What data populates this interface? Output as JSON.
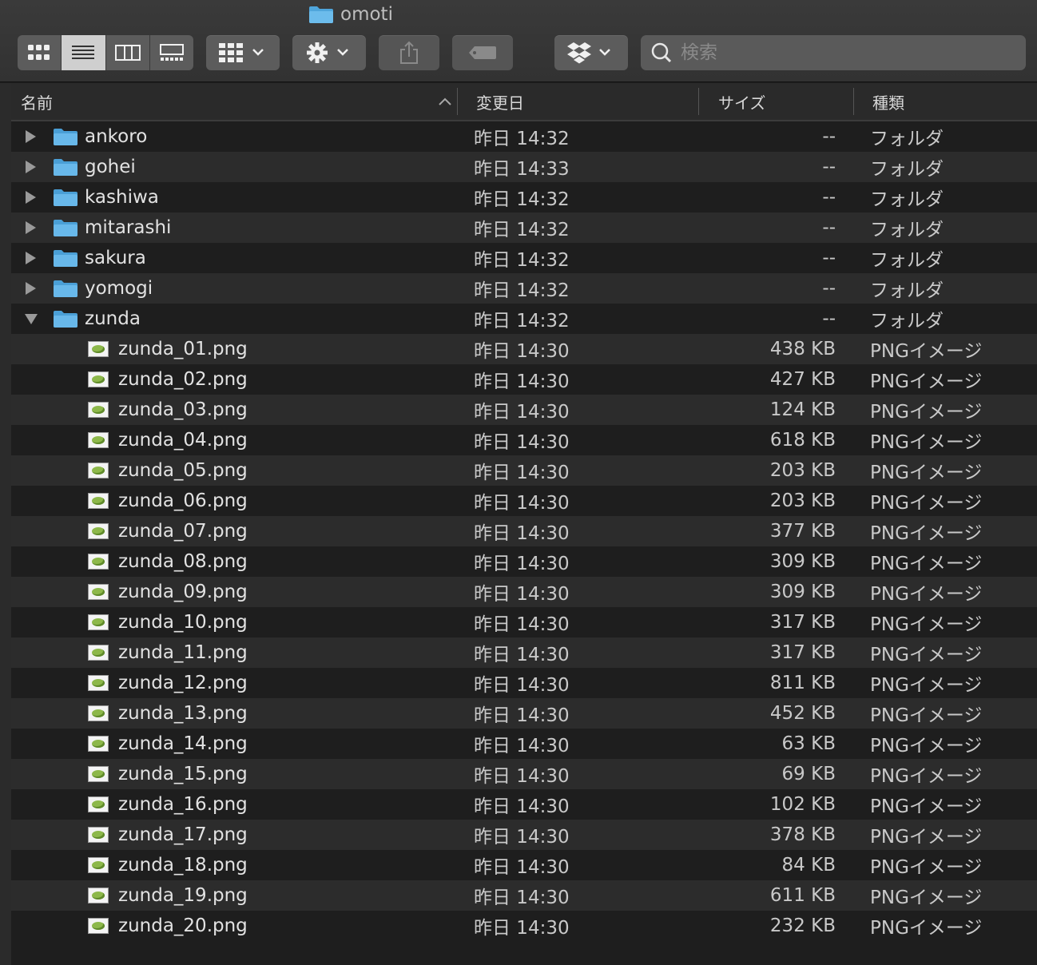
{
  "window": {
    "title": "omoti"
  },
  "toolbar": {
    "view_icons": [
      "icon-view-icon",
      "list-view-icon",
      "column-view-icon",
      "gallery-view-icon"
    ],
    "active_view": "list",
    "search_placeholder": "検索"
  },
  "columns": {
    "name": "名前",
    "modified": "変更日",
    "size": "サイズ",
    "kind": "種類"
  },
  "folders": [
    {
      "name": "ankoro",
      "date": "昨日 14:32",
      "size": "--",
      "kind": "フォルダ",
      "expanded": false
    },
    {
      "name": "gohei",
      "date": "昨日 14:33",
      "size": "--",
      "kind": "フォルダ",
      "expanded": false
    },
    {
      "name": "kashiwa",
      "date": "昨日 14:32",
      "size": "--",
      "kind": "フォルダ",
      "expanded": false
    },
    {
      "name": "mitarashi",
      "date": "昨日 14:32",
      "size": "--",
      "kind": "フォルダ",
      "expanded": false
    },
    {
      "name": "sakura",
      "date": "昨日 14:32",
      "size": "--",
      "kind": "フォルダ",
      "expanded": false
    },
    {
      "name": "yomogi",
      "date": "昨日 14:32",
      "size": "--",
      "kind": "フォルダ",
      "expanded": false
    },
    {
      "name": "zunda",
      "date": "昨日 14:32",
      "size": "--",
      "kind": "フォルダ",
      "expanded": true
    }
  ],
  "files": [
    {
      "name": "zunda_01.png",
      "date": "昨日 14:30",
      "size": "438 KB",
      "kind": "PNGイメージ"
    },
    {
      "name": "zunda_02.png",
      "date": "昨日 14:30",
      "size": "427 KB",
      "kind": "PNGイメージ"
    },
    {
      "name": "zunda_03.png",
      "date": "昨日 14:30",
      "size": "124 KB",
      "kind": "PNGイメージ"
    },
    {
      "name": "zunda_04.png",
      "date": "昨日 14:30",
      "size": "618 KB",
      "kind": "PNGイメージ"
    },
    {
      "name": "zunda_05.png",
      "date": "昨日 14:30",
      "size": "203 KB",
      "kind": "PNGイメージ"
    },
    {
      "name": "zunda_06.png",
      "date": "昨日 14:30",
      "size": "203 KB",
      "kind": "PNGイメージ"
    },
    {
      "name": "zunda_07.png",
      "date": "昨日 14:30",
      "size": "377 KB",
      "kind": "PNGイメージ"
    },
    {
      "name": "zunda_08.png",
      "date": "昨日 14:30",
      "size": "309 KB",
      "kind": "PNGイメージ"
    },
    {
      "name": "zunda_09.png",
      "date": "昨日 14:30",
      "size": "309 KB",
      "kind": "PNGイメージ"
    },
    {
      "name": "zunda_10.png",
      "date": "昨日 14:30",
      "size": "317 KB",
      "kind": "PNGイメージ"
    },
    {
      "name": "zunda_11.png",
      "date": "昨日 14:30",
      "size": "317 KB",
      "kind": "PNGイメージ"
    },
    {
      "name": "zunda_12.png",
      "date": "昨日 14:30",
      "size": "811 KB",
      "kind": "PNGイメージ"
    },
    {
      "name": "zunda_13.png",
      "date": "昨日 14:30",
      "size": "452 KB",
      "kind": "PNGイメージ"
    },
    {
      "name": "zunda_14.png",
      "date": "昨日 14:30",
      "size": "63 KB",
      "kind": "PNGイメージ"
    },
    {
      "name": "zunda_15.png",
      "date": "昨日 14:30",
      "size": "69 KB",
      "kind": "PNGイメージ"
    },
    {
      "name": "zunda_16.png",
      "date": "昨日 14:30",
      "size": "102 KB",
      "kind": "PNGイメージ"
    },
    {
      "name": "zunda_17.png",
      "date": "昨日 14:30",
      "size": "378 KB",
      "kind": "PNGイメージ"
    },
    {
      "name": "zunda_18.png",
      "date": "昨日 14:30",
      "size": "84 KB",
      "kind": "PNGイメージ"
    },
    {
      "name": "zunda_19.png",
      "date": "昨日 14:30",
      "size": "611 KB",
      "kind": "PNGイメージ"
    },
    {
      "name": "zunda_20.png",
      "date": "昨日 14:30",
      "size": "232 KB",
      "kind": "PNGイメージ"
    }
  ]
}
